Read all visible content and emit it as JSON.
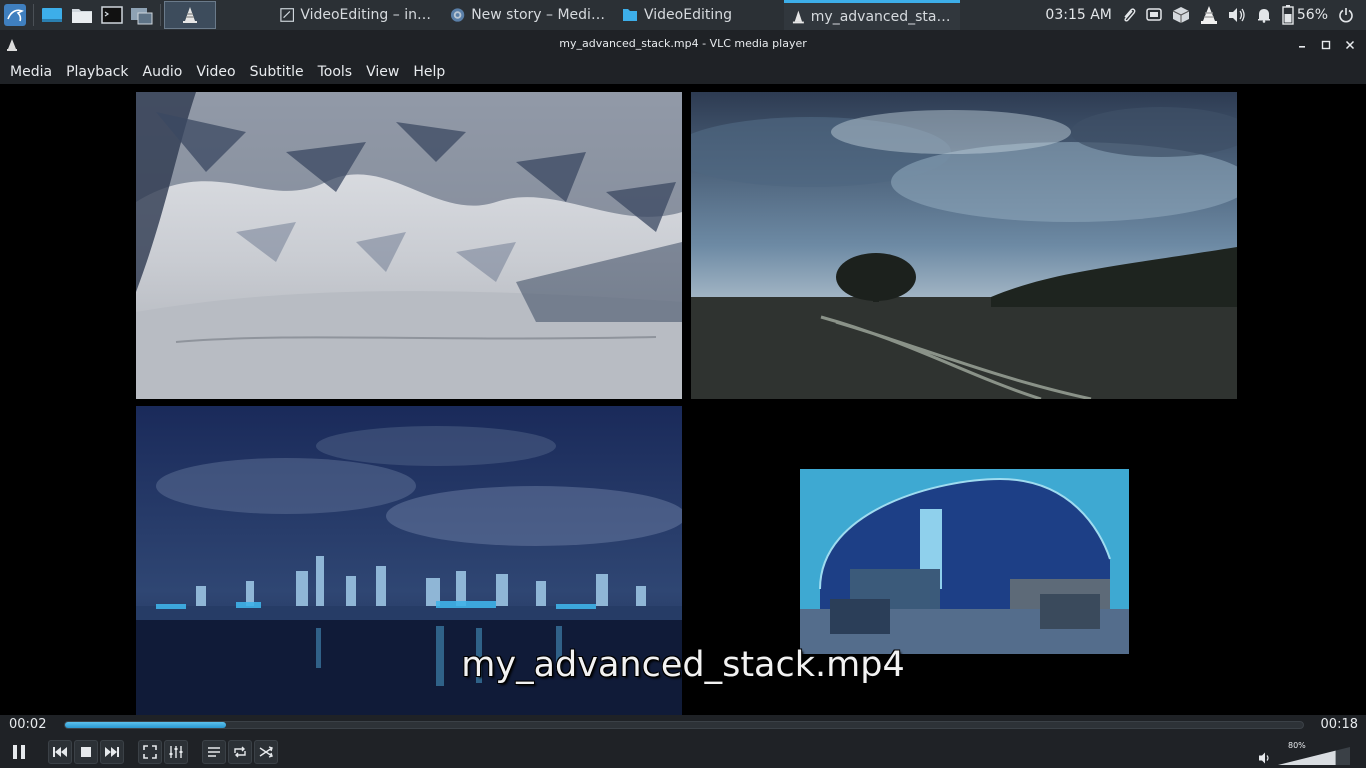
{
  "taskbar": {
    "launchers": [
      {
        "icon": "kali-menu-icon"
      },
      {
        "icon": "show-desktop-icon"
      },
      {
        "icon": "file-manager-icon"
      },
      {
        "icon": "terminal-icon"
      },
      {
        "icon": "screenshot-icon"
      }
    ],
    "tasks": [
      {
        "icon": "vlc-cone-icon",
        "label": "",
        "active": true
      },
      {
        "icon": "editor-window-icon",
        "label": "VideoEditing – intro..."
      },
      {
        "icon": "browser-globe-icon",
        "label": "New story – Mediu..."
      },
      {
        "icon": "folder-icon",
        "label": "VideoEditing"
      },
      {
        "icon": "vlc-cone-icon",
        "label": "my_advanced_stack...",
        "active": true
      }
    ],
    "clock": "03:15 AM",
    "battery_percent": "56%",
    "tray_icons": [
      "paperclip-icon",
      "window-icon",
      "package-icon",
      "vlc-tray-icon",
      "volume-icon",
      "notifications-bell-icon",
      "battery-icon",
      "power-icon"
    ]
  },
  "window": {
    "title": "my_advanced_stack.mp4 - VLC media player",
    "controls": [
      "minimize-icon",
      "maximize-icon",
      "close-icon"
    ]
  },
  "menu": [
    "Media",
    "Playback",
    "Audio",
    "Video",
    "Subtitle",
    "Tools",
    "View",
    "Help"
  ],
  "video": {
    "osd_title": "my_advanced_stack.mp4",
    "tiles": [
      "snow-slope-video",
      "field-tree-video",
      "city-night-video",
      "underwater-dome-video"
    ]
  },
  "player": {
    "time_current": "00:02",
    "time_total": "00:18",
    "progress_fraction": 0.13,
    "volume_label": "80%",
    "volume_fraction": 0.8
  },
  "colors": {
    "accent": "#3daee9",
    "panel_bg": "#1f2226",
    "taskbar_bg": "#2b3035"
  }
}
